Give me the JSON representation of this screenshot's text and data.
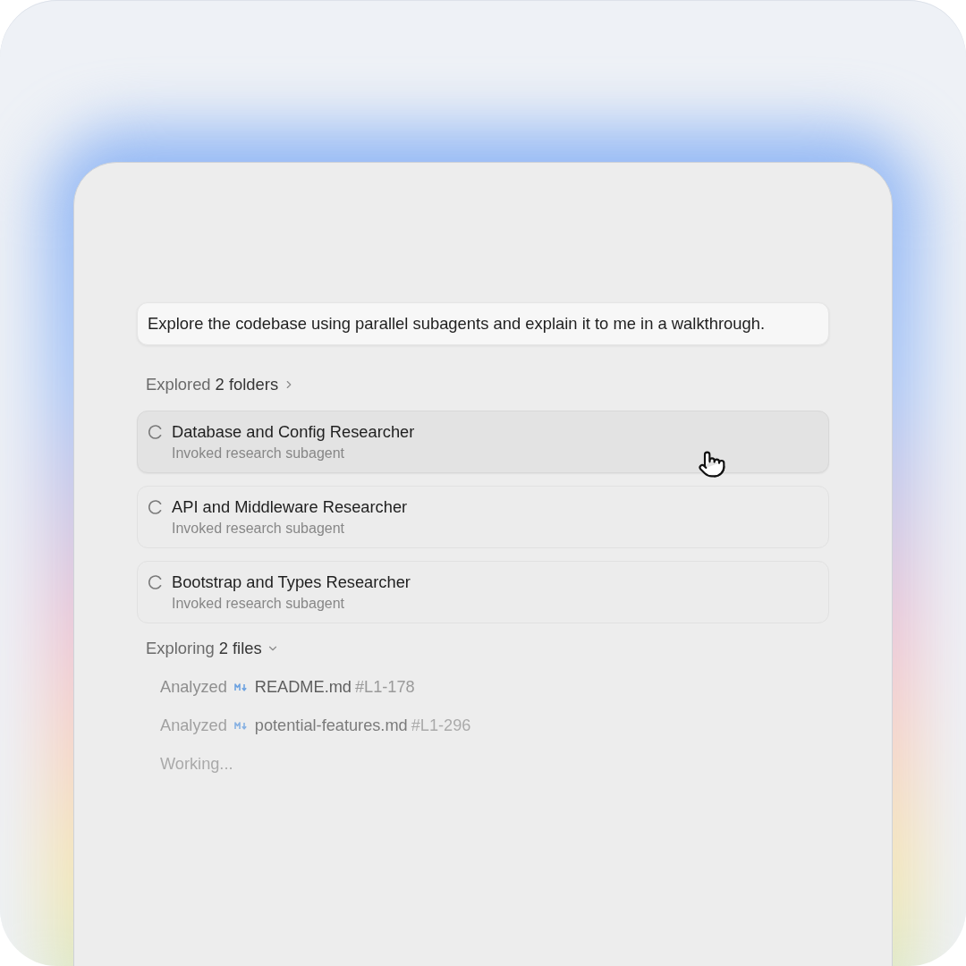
{
  "prompt": {
    "text": "Explore the codebase using parallel subagents and explain it to me in a walkthrough."
  },
  "steps": [
    {
      "kind": "group",
      "verb": "Explored",
      "detail": "2 folders",
      "expanded": false
    },
    {
      "kind": "subagent",
      "title": "Database and Config Researcher",
      "subtitle": "Invoked research subagent",
      "loading": true,
      "hovered": true
    },
    {
      "kind": "subagent",
      "title": "API and Middleware Researcher",
      "subtitle": "Invoked research subagent",
      "loading": true,
      "hovered": false
    },
    {
      "kind": "subagent",
      "title": "Bootstrap and Types Researcher",
      "subtitle": "Invoked research subagent",
      "loading": true,
      "hovered": false
    },
    {
      "kind": "group",
      "verb": "Exploring",
      "detail": "2 files",
      "expanded": true,
      "children": [
        {
          "kind": "file",
          "action": "Analyzed",
          "file": "README.md",
          "lines": "#L1-178"
        },
        {
          "kind": "file",
          "action": "Analyzed",
          "file": "potential-features.md",
          "lines": "#L1-296"
        },
        {
          "kind": "status",
          "text": "Working..."
        }
      ]
    }
  ]
}
